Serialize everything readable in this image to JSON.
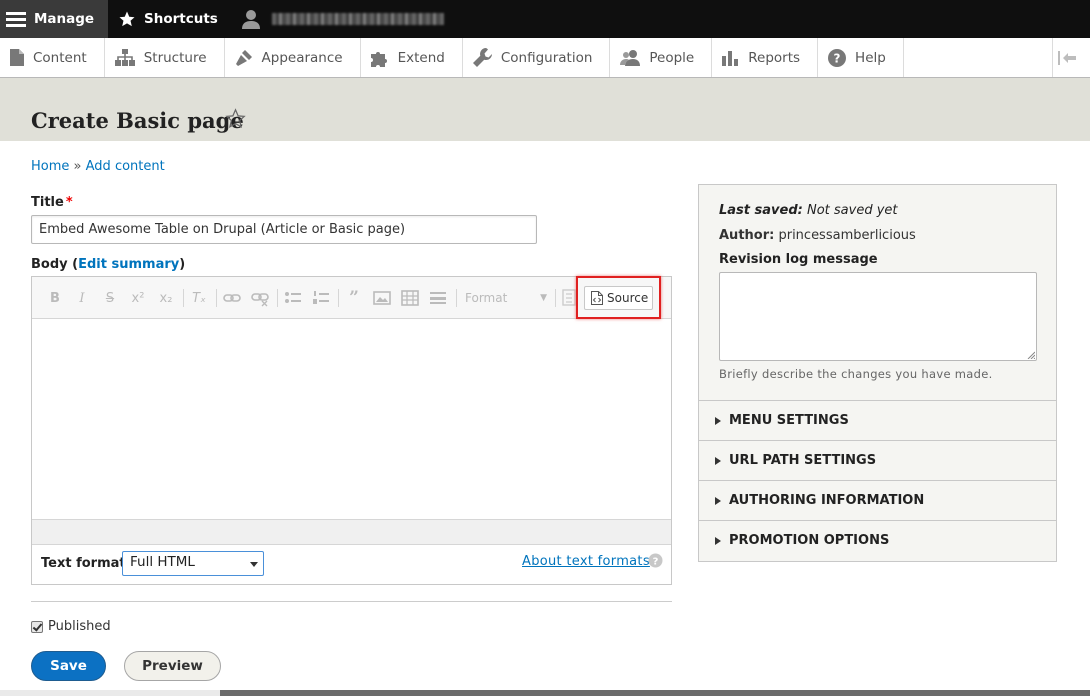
{
  "toolbar": {
    "manage_label": "Manage",
    "shortcuts_label": "Shortcuts"
  },
  "tray": {
    "items": [
      {
        "label": "Content",
        "icon": "page-icon"
      },
      {
        "label": "Structure",
        "icon": "structure-icon"
      },
      {
        "label": "Appearance",
        "icon": "brush-icon"
      },
      {
        "label": "Extend",
        "icon": "puzzle-icon"
      },
      {
        "label": "Configuration",
        "icon": "wrench-icon"
      },
      {
        "label": "People",
        "icon": "people-icon"
      },
      {
        "label": "Reports",
        "icon": "bar-chart-icon"
      },
      {
        "label": "Help",
        "icon": "question-icon"
      }
    ]
  },
  "page": {
    "title": "Create Basic page"
  },
  "breadcrumb": {
    "home": "Home",
    "separator": "»",
    "add_content": "Add content"
  },
  "form": {
    "title_label": "Title",
    "required_mark": "*",
    "title_value": "Embed Awesome Table on Drupal (Article or Basic page)",
    "body_label": "Body",
    "body_open": "(",
    "edit_summary": "Edit summary",
    "body_close": ")",
    "format_placeholder": "Format",
    "source_label": "Source",
    "text_format_label": "Text format",
    "text_format_value": "Full HTML",
    "about_formats": "About text formats",
    "published_label": "Published",
    "save_label": "Save",
    "preview_label": "Preview"
  },
  "sidebar": {
    "last_saved_label": "Last saved:",
    "last_saved_value": "Not saved yet",
    "author_label": "Author:",
    "author_value": "princessamberlicious",
    "revision_label": "Revision log message",
    "revision_help": "Briefly describe the changes you have made.",
    "sections": [
      "MENU SETTINGS",
      "URL PATH SETTINGS",
      "AUTHORING INFORMATION",
      "PROMOTION OPTIONS"
    ]
  },
  "colors": {
    "accent": "#0074bd",
    "save_button": "#0c71c3",
    "highlight": "#e02020",
    "topbar": "#0f0f0f"
  }
}
